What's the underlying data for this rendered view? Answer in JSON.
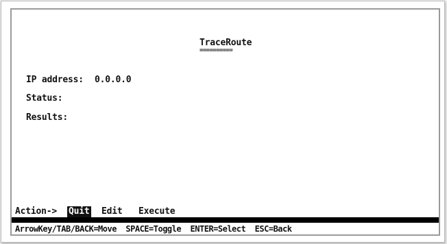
{
  "screen": {
    "title": "TraceRoute",
    "title_underline": "=========="
  },
  "fields": {
    "ip_label": "IP address:",
    "ip_value": "0.0.0.0",
    "status_label": "Status:",
    "results_label": "Results:"
  },
  "actions": {
    "prompt": "Action->",
    "quit": "Quit",
    "edit": "Edit",
    "execute": "Execute",
    "selected": "Quit"
  },
  "help": {
    "text": "ArrowKey/TAB/BACK=Move  SPACE=Toggle  ENTER=Select  ESC=Back"
  },
  "colors": {
    "background": "#ffffff",
    "text": "#111111",
    "highlight_bg": "#111111",
    "highlight_fg": "#ffffff"
  }
}
